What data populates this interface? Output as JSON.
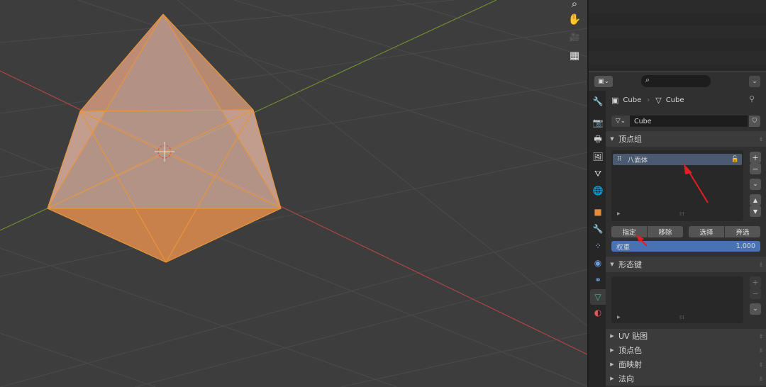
{
  "viewport": {
    "gizmos": [
      {
        "name": "zoom-icon",
        "glyph": "⌕"
      },
      {
        "name": "pan-hand-icon",
        "glyph": "✋"
      },
      {
        "name": "camera-icon",
        "glyph": "🎥"
      },
      {
        "name": "perspective-grid-icon",
        "glyph": "▦"
      }
    ],
    "colors": {
      "mesh_fill": "#c89a84",
      "mesh_edge": "#e8943a",
      "x_axis": "#b04545",
      "y_axis": "#6e8c2e"
    }
  },
  "properties": {
    "editor_type_icon": "editor-type-icon",
    "search_icon": "search-icon",
    "breadcrumb": {
      "object": "Cube",
      "separator": "›",
      "data": "Cube"
    },
    "mesh_name": "Cube",
    "vertex_groups": {
      "title": "顶点组",
      "items": [
        {
          "name": "八面体"
        }
      ],
      "add": "+",
      "remove": "−",
      "assign": "指定",
      "remove_from": "移除",
      "select": "选择",
      "deselect": "弃选",
      "weight_label": "权重",
      "weight_value": "1.000"
    },
    "shape_keys": {
      "title": "形态键",
      "add": "+",
      "remove": "−"
    },
    "collapsed_panels": [
      "UV 贴图",
      "顶点色",
      "面映射",
      "法向"
    ],
    "tabs": [
      {
        "name": "tool-tab-icon",
        "glyph": "🔧"
      },
      {
        "name": "render-tab-icon",
        "glyph": "📷"
      },
      {
        "name": "output-tab-icon",
        "glyph": "🖶"
      },
      {
        "name": "view-layer-tab-icon",
        "glyph": "🖼"
      },
      {
        "name": "scene-tab-icon",
        "glyph": "⛛"
      },
      {
        "name": "world-tab-icon",
        "glyph": "🌐"
      },
      {
        "name": "object-tab-icon",
        "glyph": "■"
      },
      {
        "name": "modifiers-tab-icon",
        "glyph": "🔧"
      },
      {
        "name": "particles-tab-icon",
        "glyph": "⁘"
      },
      {
        "name": "physics-tab-icon",
        "glyph": "◉"
      },
      {
        "name": "constraints-tab-icon",
        "glyph": "⚭"
      },
      {
        "name": "data-tab-icon",
        "glyph": "▽"
      },
      {
        "name": "material-tab-icon",
        "glyph": "◐"
      }
    ],
    "accent": "#4772b3"
  }
}
